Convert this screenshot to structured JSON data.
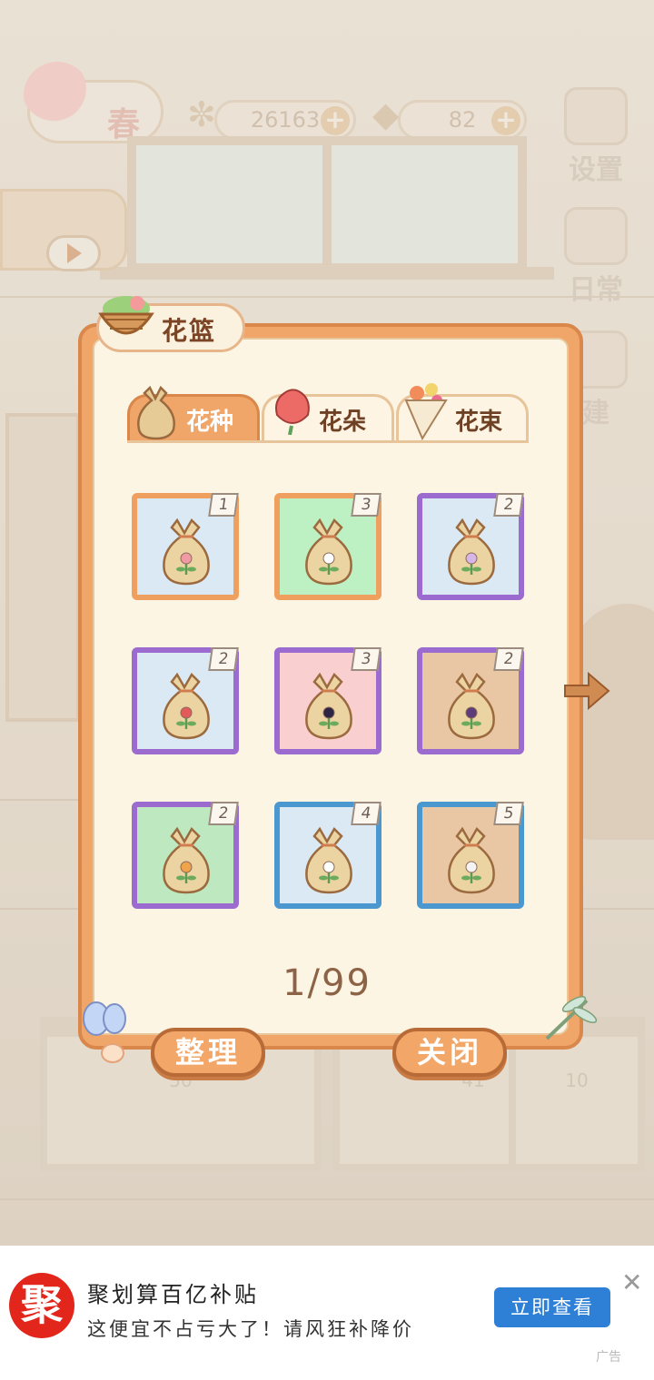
{
  "background": {
    "season_label": "春",
    "coins": "26163",
    "cheese": "82",
    "settings_label": "设置",
    "daily_label": "日常",
    "build_label": "建",
    "bench_numbers": [
      "50",
      "41",
      "10"
    ]
  },
  "modal": {
    "title": "花篮",
    "tabs": [
      {
        "label": "花种",
        "active": true
      },
      {
        "label": "花朵",
        "active": false
      },
      {
        "label": "花束",
        "active": false
      }
    ],
    "slots": [
      {
        "count": "1",
        "bg": "#dbe9f5",
        "border": "#f0a05e",
        "flower": "#f19aa6"
      },
      {
        "count": "3",
        "bg": "#bdf0c2",
        "border": "#f0a05e",
        "flower": "#ffffff"
      },
      {
        "count": "2",
        "bg": "#dbe9f5",
        "border": "#9b6bd0",
        "flower": "#d6b6e6"
      },
      {
        "count": "2",
        "bg": "#dbe9f5",
        "border": "#9b6bd0",
        "flower": "#e25a5a"
      },
      {
        "count": "3",
        "bg": "#f9cfcf",
        "border": "#9b6bd0",
        "flower": "#2e2444"
      },
      {
        "count": "2",
        "bg": "#e9c7a5",
        "border": "#9b6bd0",
        "flower": "#5d3c7a"
      },
      {
        "count": "2",
        "bg": "#bde8c0",
        "border": "#9b6bd0",
        "flower": "#f0a34a"
      },
      {
        "count": "4",
        "bg": "#dbe9f5",
        "border": "#4b97cf",
        "flower": "#ffffff"
      },
      {
        "count": "5",
        "bg": "#e9c7a5",
        "border": "#4b97cf",
        "flower": "#f4f4f4"
      }
    ],
    "page": "1/99",
    "organize_label": "整理",
    "close_label": "关闭"
  },
  "ad": {
    "logo": "聚",
    "title": "聚划算百亿补贴",
    "desc": "这便宜不占亏大了！请风狂补降价",
    "cta": "立即查看",
    "close": "✕",
    "tag": "广告"
  }
}
